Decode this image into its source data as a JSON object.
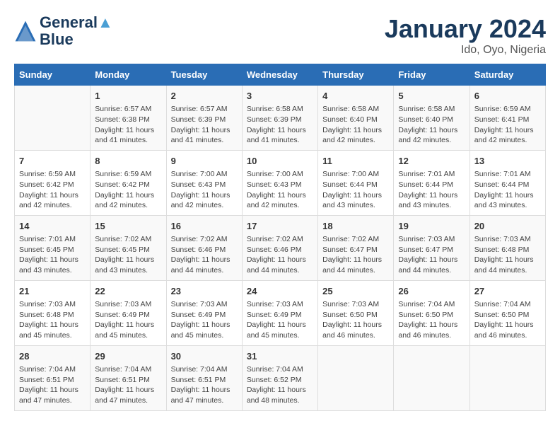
{
  "logo": {
    "line1": "General",
    "line2": "Blue"
  },
  "title": "January 2024",
  "subtitle": "Ido, Oyo, Nigeria",
  "days_of_week": [
    "Sunday",
    "Monday",
    "Tuesday",
    "Wednesday",
    "Thursday",
    "Friday",
    "Saturday"
  ],
  "weeks": [
    [
      {
        "day": "",
        "sunrise": "",
        "sunset": "",
        "daylight": ""
      },
      {
        "day": "1",
        "sunrise": "Sunrise: 6:57 AM",
        "sunset": "Sunset: 6:38 PM",
        "daylight": "Daylight: 11 hours and 41 minutes."
      },
      {
        "day": "2",
        "sunrise": "Sunrise: 6:57 AM",
        "sunset": "Sunset: 6:39 PM",
        "daylight": "Daylight: 11 hours and 41 minutes."
      },
      {
        "day": "3",
        "sunrise": "Sunrise: 6:58 AM",
        "sunset": "Sunset: 6:39 PM",
        "daylight": "Daylight: 11 hours and 41 minutes."
      },
      {
        "day": "4",
        "sunrise": "Sunrise: 6:58 AM",
        "sunset": "Sunset: 6:40 PM",
        "daylight": "Daylight: 11 hours and 42 minutes."
      },
      {
        "day": "5",
        "sunrise": "Sunrise: 6:58 AM",
        "sunset": "Sunset: 6:40 PM",
        "daylight": "Daylight: 11 hours and 42 minutes."
      },
      {
        "day": "6",
        "sunrise": "Sunrise: 6:59 AM",
        "sunset": "Sunset: 6:41 PM",
        "daylight": "Daylight: 11 hours and 42 minutes."
      }
    ],
    [
      {
        "day": "7",
        "sunrise": "Sunrise: 6:59 AM",
        "sunset": "Sunset: 6:42 PM",
        "daylight": "Daylight: 11 hours and 42 minutes."
      },
      {
        "day": "8",
        "sunrise": "Sunrise: 6:59 AM",
        "sunset": "Sunset: 6:42 PM",
        "daylight": "Daylight: 11 hours and 42 minutes."
      },
      {
        "day": "9",
        "sunrise": "Sunrise: 7:00 AM",
        "sunset": "Sunset: 6:43 PM",
        "daylight": "Daylight: 11 hours and 42 minutes."
      },
      {
        "day": "10",
        "sunrise": "Sunrise: 7:00 AM",
        "sunset": "Sunset: 6:43 PM",
        "daylight": "Daylight: 11 hours and 42 minutes."
      },
      {
        "day": "11",
        "sunrise": "Sunrise: 7:00 AM",
        "sunset": "Sunset: 6:44 PM",
        "daylight": "Daylight: 11 hours and 43 minutes."
      },
      {
        "day": "12",
        "sunrise": "Sunrise: 7:01 AM",
        "sunset": "Sunset: 6:44 PM",
        "daylight": "Daylight: 11 hours and 43 minutes."
      },
      {
        "day": "13",
        "sunrise": "Sunrise: 7:01 AM",
        "sunset": "Sunset: 6:44 PM",
        "daylight": "Daylight: 11 hours and 43 minutes."
      }
    ],
    [
      {
        "day": "14",
        "sunrise": "Sunrise: 7:01 AM",
        "sunset": "Sunset: 6:45 PM",
        "daylight": "Daylight: 11 hours and 43 minutes."
      },
      {
        "day": "15",
        "sunrise": "Sunrise: 7:02 AM",
        "sunset": "Sunset: 6:45 PM",
        "daylight": "Daylight: 11 hours and 43 minutes."
      },
      {
        "day": "16",
        "sunrise": "Sunrise: 7:02 AM",
        "sunset": "Sunset: 6:46 PM",
        "daylight": "Daylight: 11 hours and 44 minutes."
      },
      {
        "day": "17",
        "sunrise": "Sunrise: 7:02 AM",
        "sunset": "Sunset: 6:46 PM",
        "daylight": "Daylight: 11 hours and 44 minutes."
      },
      {
        "day": "18",
        "sunrise": "Sunrise: 7:02 AM",
        "sunset": "Sunset: 6:47 PM",
        "daylight": "Daylight: 11 hours and 44 minutes."
      },
      {
        "day": "19",
        "sunrise": "Sunrise: 7:03 AM",
        "sunset": "Sunset: 6:47 PM",
        "daylight": "Daylight: 11 hours and 44 minutes."
      },
      {
        "day": "20",
        "sunrise": "Sunrise: 7:03 AM",
        "sunset": "Sunset: 6:48 PM",
        "daylight": "Daylight: 11 hours and 44 minutes."
      }
    ],
    [
      {
        "day": "21",
        "sunrise": "Sunrise: 7:03 AM",
        "sunset": "Sunset: 6:48 PM",
        "daylight": "Daylight: 11 hours and 45 minutes."
      },
      {
        "day": "22",
        "sunrise": "Sunrise: 7:03 AM",
        "sunset": "Sunset: 6:49 PM",
        "daylight": "Daylight: 11 hours and 45 minutes."
      },
      {
        "day": "23",
        "sunrise": "Sunrise: 7:03 AM",
        "sunset": "Sunset: 6:49 PM",
        "daylight": "Daylight: 11 hours and 45 minutes."
      },
      {
        "day": "24",
        "sunrise": "Sunrise: 7:03 AM",
        "sunset": "Sunset: 6:49 PM",
        "daylight": "Daylight: 11 hours and 45 minutes."
      },
      {
        "day": "25",
        "sunrise": "Sunrise: 7:03 AM",
        "sunset": "Sunset: 6:50 PM",
        "daylight": "Daylight: 11 hours and 46 minutes."
      },
      {
        "day": "26",
        "sunrise": "Sunrise: 7:04 AM",
        "sunset": "Sunset: 6:50 PM",
        "daylight": "Daylight: 11 hours and 46 minutes."
      },
      {
        "day": "27",
        "sunrise": "Sunrise: 7:04 AM",
        "sunset": "Sunset: 6:50 PM",
        "daylight": "Daylight: 11 hours and 46 minutes."
      }
    ],
    [
      {
        "day": "28",
        "sunrise": "Sunrise: 7:04 AM",
        "sunset": "Sunset: 6:51 PM",
        "daylight": "Daylight: 11 hours and 47 minutes."
      },
      {
        "day": "29",
        "sunrise": "Sunrise: 7:04 AM",
        "sunset": "Sunset: 6:51 PM",
        "daylight": "Daylight: 11 hours and 47 minutes."
      },
      {
        "day": "30",
        "sunrise": "Sunrise: 7:04 AM",
        "sunset": "Sunset: 6:51 PM",
        "daylight": "Daylight: 11 hours and 47 minutes."
      },
      {
        "day": "31",
        "sunrise": "Sunrise: 7:04 AM",
        "sunset": "Sunset: 6:52 PM",
        "daylight": "Daylight: 11 hours and 48 minutes."
      },
      {
        "day": "",
        "sunrise": "",
        "sunset": "",
        "daylight": ""
      },
      {
        "day": "",
        "sunrise": "",
        "sunset": "",
        "daylight": ""
      },
      {
        "day": "",
        "sunrise": "",
        "sunset": "",
        "daylight": ""
      }
    ]
  ]
}
